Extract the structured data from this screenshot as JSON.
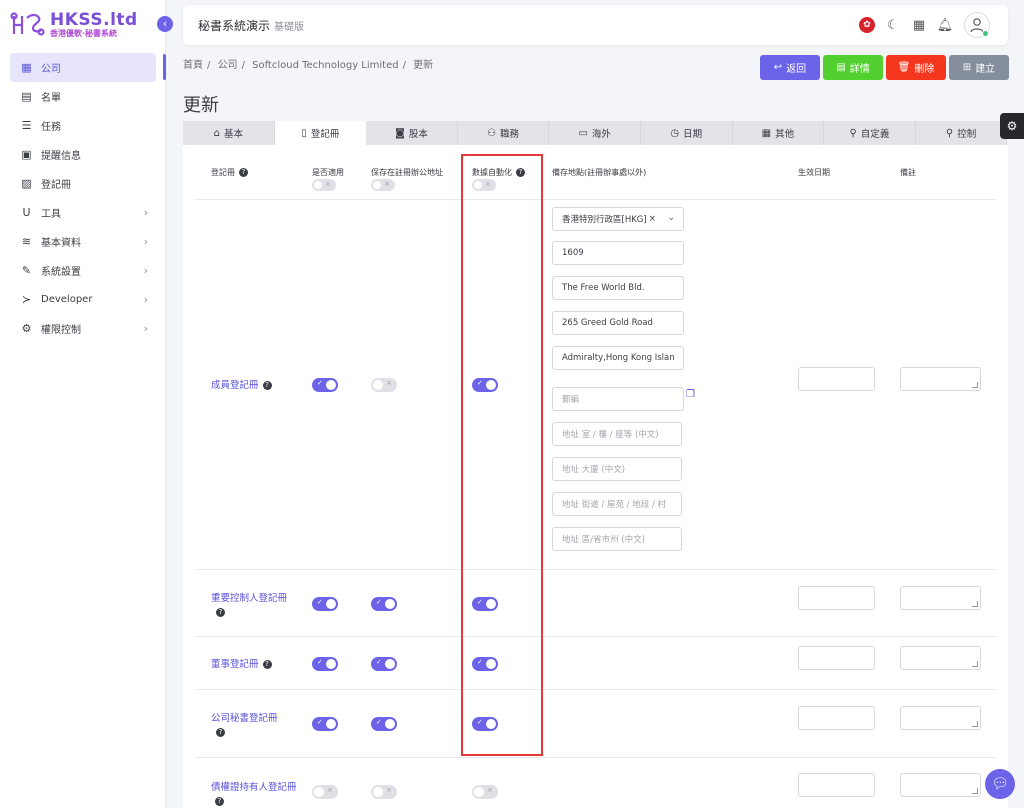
{
  "brand": {
    "name": "HKSS.ltd",
    "subtitle": "香港優軟·秘書系統"
  },
  "sidebar": {
    "items": [
      {
        "label": "公司",
        "icon": "building-icon",
        "glyph": "▦",
        "active": true,
        "chevron": false
      },
      {
        "label": "名單",
        "icon": "contact-card-icon",
        "glyph": "▤",
        "active": false,
        "chevron": false
      },
      {
        "label": "任務",
        "icon": "task-list-icon",
        "glyph": "☰",
        "active": false,
        "chevron": false
      },
      {
        "label": "提醒信息",
        "icon": "calendar-icon",
        "glyph": "▣",
        "active": false,
        "chevron": false
      },
      {
        "label": "登記冊",
        "icon": "register-book-icon",
        "glyph": "▨",
        "active": false,
        "chevron": false
      },
      {
        "label": "工具",
        "icon": "magnet-icon",
        "glyph": "Ս",
        "active": false,
        "chevron": true
      },
      {
        "label": "基本資料",
        "icon": "database-icon",
        "glyph": "≋",
        "active": false,
        "chevron": true
      },
      {
        "label": "系統設置",
        "icon": "wrench-icon",
        "glyph": "✎",
        "active": false,
        "chevron": true
      },
      {
        "label": "Developer",
        "icon": "terminal-icon",
        "glyph": "≻",
        "active": false,
        "chevron": true
      },
      {
        "label": "權限控制",
        "icon": "gears-icon",
        "glyph": "⚙",
        "active": false,
        "chevron": true
      }
    ]
  },
  "topbar": {
    "title": "秘書系統演示",
    "version": "基礎版"
  },
  "breadcrumb": [
    "首頁",
    "公司",
    "Softcloud Technology Limited",
    "更新"
  ],
  "actions": {
    "back": "返回",
    "detail": "詳情",
    "delete": "刪除",
    "create": "建立"
  },
  "page_title": "更新",
  "tabs": [
    {
      "label": "基本",
      "icon": "home-icon",
      "glyph": "⌂",
      "active": false
    },
    {
      "label": "登記冊",
      "icon": "document-icon",
      "glyph": "▯",
      "active": true
    },
    {
      "label": "股本",
      "icon": "money-icon",
      "glyph": "◙",
      "active": false
    },
    {
      "label": "職務",
      "icon": "people-icon",
      "glyph": "⚇",
      "active": false
    },
    {
      "label": "海外",
      "icon": "server-icon",
      "glyph": "▭",
      "active": false
    },
    {
      "label": "日期",
      "icon": "clock-icon",
      "glyph": "◷",
      "active": false
    },
    {
      "label": "其他",
      "icon": "grid-icon",
      "glyph": "▦",
      "active": false
    },
    {
      "label": "自定義",
      "icon": "user-check-icon",
      "glyph": "⚲",
      "active": false
    },
    {
      "label": "控制",
      "icon": "user-cog-icon",
      "glyph": "⚲",
      "active": false
    }
  ],
  "table": {
    "headers": {
      "register": "登記冊",
      "applicable": "是否適用",
      "keep_at_office": "保存在註冊辦公地址",
      "automation": "數據自動化",
      "location": "備存地點(註冊辦事處以外)",
      "effective_date": "生效日期",
      "remarks": "備註"
    },
    "address_fields": {
      "country": "香港特別行政區[HKG]",
      "room": "1609",
      "building": "The Free World Bld.",
      "street": "265 Greed Gold Road",
      "district": "Admiralty,Hong Kong Islan",
      "postcode_placeholder": "郵編",
      "room_cn_placeholder": "地址 室 / 樓 / 座等 (中文)",
      "building_cn_placeholder": "地址 大廈 (中文)",
      "street_cn_placeholder": "地址 街道 / 屋苑 / 地段 / 村",
      "district_cn_placeholder": "地址 區/省市州 (中文)"
    },
    "rows": [
      {
        "label": "成員登記冊",
        "applicable": true,
        "keep_at_office": false,
        "automation": true
      },
      {
        "label": "重要控制人登記冊",
        "applicable": true,
        "keep_at_office": true,
        "automation": true
      },
      {
        "label": "董事登記冊",
        "applicable": true,
        "keep_at_office": true,
        "automation": true
      },
      {
        "label": "公司秘書登記冊",
        "applicable": true,
        "keep_at_office": true,
        "automation": true
      },
      {
        "label": "債權證持有人登記冊",
        "applicable": false,
        "keep_at_office": false,
        "automation": false
      }
    ]
  },
  "colors": {
    "accent": "#6c63e8",
    "success": "#52d02f",
    "danger": "#f5361f",
    "muted": "#848e9c",
    "highlight": "#e53935"
  }
}
